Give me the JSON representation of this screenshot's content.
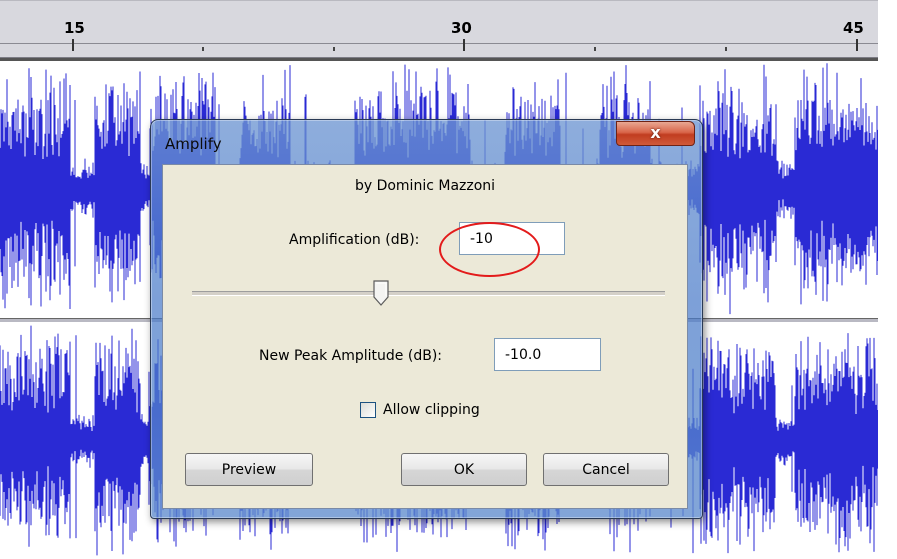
{
  "ruler": {
    "labels": [
      "15",
      "30",
      "45"
    ]
  },
  "dialog": {
    "title": "Amplify",
    "close_glyph": "x",
    "byline": "by Dominic Mazzoni",
    "amplification_label": "Amplification (dB):",
    "amplification_value": "-10",
    "slider_level": 0.4,
    "peak_label": "New Peak Amplitude (dB):",
    "peak_value": "-10.0",
    "clipping_label": "Allow clipping",
    "clipping_checked": false,
    "buttons": {
      "preview": "Preview",
      "ok": "OK",
      "cancel": "Cancel"
    }
  },
  "colors": {
    "waveform": "#2a2ad4",
    "close_button": "#c9452a",
    "focus_ring": "#e31b1b"
  }
}
